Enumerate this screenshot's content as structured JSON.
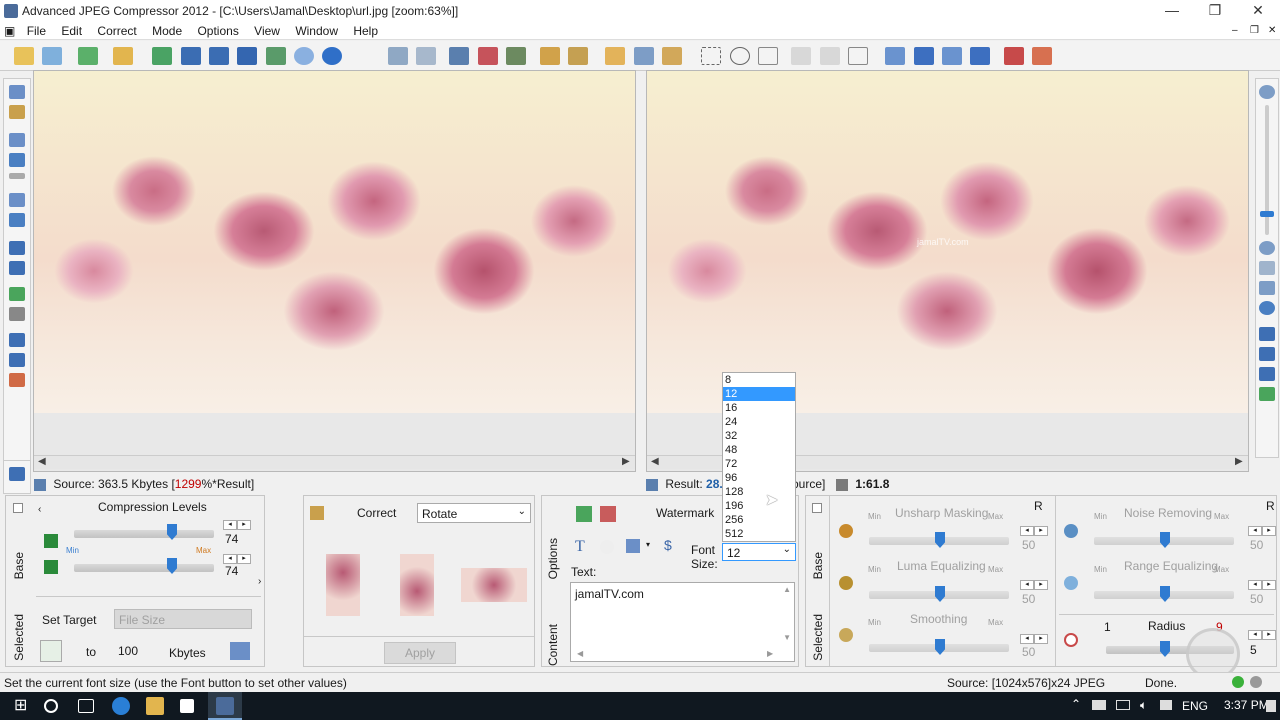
{
  "window": {
    "title": "Advanced JPEG Compressor 2012 - [C:\\Users\\Jamal\\Desktop\\url.jpg  [zoom:63%]]"
  },
  "menu": [
    "File",
    "Edit",
    "Correct",
    "Mode",
    "Options",
    "View",
    "Window",
    "Help"
  ],
  "status_strip": {
    "source": "Source: 363.5 Kbytes",
    "source_pct_prefix": "[",
    "source_pct": "1299",
    "source_pct_suffix": "%*Result]",
    "result_prefix": "Result:",
    "result_value": "28.0",
    "result_tail": "ource]",
    "ratio": "1:61.8"
  },
  "compression": {
    "title": "Compression Levels",
    "value1": "74",
    "value2": "74",
    "min": "Min",
    "max": "Max"
  },
  "target": {
    "label": "Set Target",
    "select": "File Size",
    "to": "to",
    "value": "100",
    "unit": "Kbytes"
  },
  "side_tabs": {
    "base": "Base",
    "selected": "Selected",
    "options": "Options",
    "content": "Content"
  },
  "correct": {
    "label": "Correct",
    "select": "Rotate",
    "apply": "Apply"
  },
  "watermark": {
    "title": "Watermark",
    "text_label": "Text:",
    "text_value": "jamalTV.com",
    "font_size_label1": "Font",
    "font_size_label2": "Size:",
    "font_size_value": "12",
    "overlay_text": "jamalTV.com"
  },
  "font_sizes": [
    "8",
    "12",
    "16",
    "24",
    "32",
    "48",
    "72",
    "96",
    "128",
    "196",
    "256",
    "512"
  ],
  "filters": {
    "r": "R",
    "unsharp": {
      "label": "Unsharp Masking",
      "value": "50"
    },
    "luma": {
      "label": "Luma Equalizing",
      "value": "50"
    },
    "smoothing": {
      "label": "Smoothing",
      "value": "50"
    },
    "noise": {
      "label": "Noise Removing",
      "value": "50"
    },
    "range": {
      "label": "Range Equalizing",
      "value": "50"
    },
    "radius": {
      "label": "Radius",
      "min": "1",
      "max": "9",
      "value": "5"
    },
    "min": "Min",
    "max": "Max"
  },
  "statusbar": {
    "hint": "Set the current font size (use the Font button to set other values)",
    "source": "Source: [1024x576]x24 JPEG",
    "done": "Done."
  },
  "taskbar": {
    "lang": "ENG",
    "time": "3:37 PM"
  },
  "colors": {
    "accent": "#3399ff",
    "slider_thumb": "#2f7bd1",
    "result_red": "#c00000"
  }
}
